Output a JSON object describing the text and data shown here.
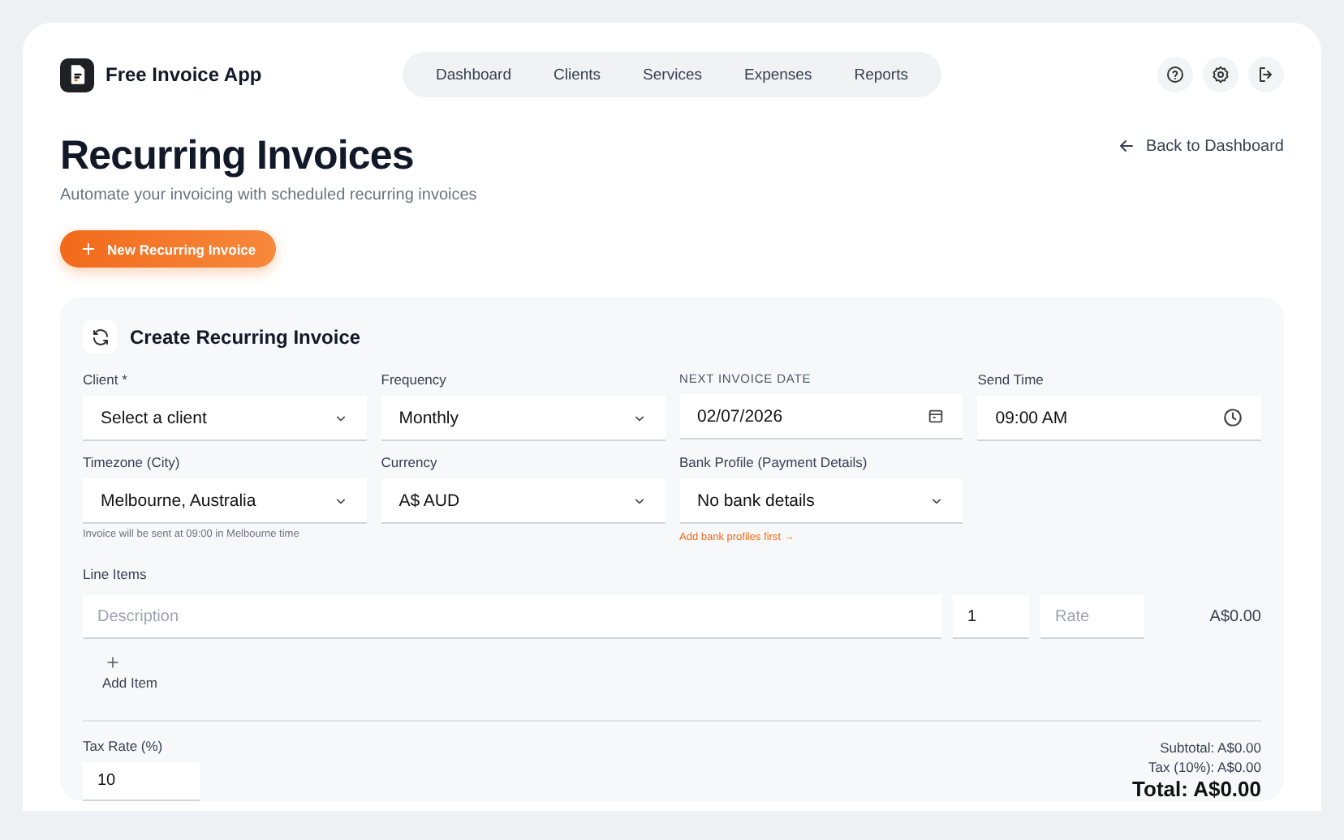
{
  "app": {
    "name": "Free Invoice App"
  },
  "nav": [
    {
      "label": "Dashboard"
    },
    {
      "label": "Clients"
    },
    {
      "label": "Services"
    },
    {
      "label": "Expenses"
    },
    {
      "label": "Reports"
    }
  ],
  "page": {
    "title": "Recurring Invoices",
    "subtitle": "Automate your invoicing with scheduled recurring invoices",
    "back_link": "Back to Dashboard",
    "new_button": "New Recurring Invoice"
  },
  "form": {
    "title": "Create Recurring Invoice",
    "fields": [
      {
        "kind": "select",
        "label": "Client *",
        "value": "Select a client"
      },
      {
        "kind": "select",
        "label": "Frequency",
        "value": "Monthly"
      },
      {
        "kind": "date",
        "label": "NEXT INVOICE DATE",
        "value": "02/07/2026"
      },
      {
        "kind": "time",
        "label": "Send Time",
        "value": "09:00 AM"
      },
      {
        "kind": "select",
        "label": "Timezone (City)",
        "value": "Melbourne, Australia",
        "hint": {
          "kind": "note",
          "text": "Invoice will be sent at 09:00 in Melbourne time"
        }
      },
      {
        "kind": "select",
        "label": "Currency",
        "value": "A$ AUD"
      },
      {
        "kind": "select",
        "label": "Bank Profile (Payment Details)",
        "value": "No bank details",
        "hint": {
          "kind": "link",
          "text": "Add bank profiles first →"
        }
      }
    ],
    "line_items": {
      "label": "Line Items",
      "rows": [
        {
          "description_placeholder": "Description",
          "quantity": "1",
          "rate_placeholder": "Rate",
          "amount": "A$0.00"
        }
      ],
      "add_button": "Add Item"
    },
    "tax": {
      "label": "Tax Rate (%)",
      "value": "10"
    },
    "totals": {
      "subtotal": "Subtotal: A$0.00",
      "tax": "Tax (10%): A$0.00",
      "total": "Total: A$0.00"
    }
  }
}
